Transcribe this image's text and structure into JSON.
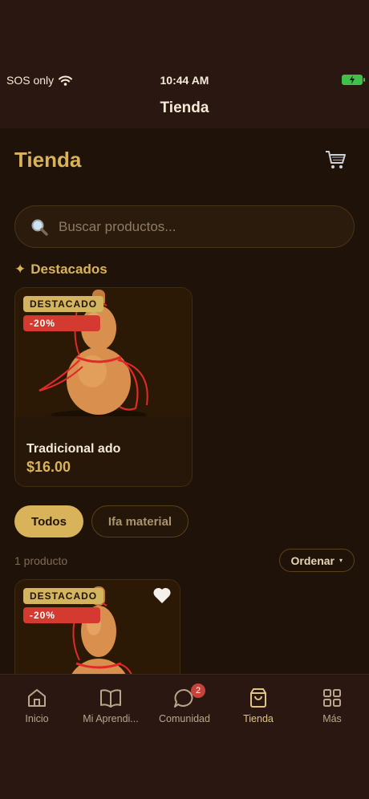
{
  "status": {
    "carrier": "SOS only",
    "time": "10:44 AM"
  },
  "nav": {
    "title": "Tienda"
  },
  "page": {
    "title": "Tienda"
  },
  "search": {
    "placeholder": "Buscar productos..."
  },
  "featured": {
    "section_label": "Destacados",
    "section_icon": "✦",
    "card": {
      "badge": "DESTACADO",
      "discount": "-20%",
      "name": "Tradicional ado",
      "price": "$16.00"
    }
  },
  "filters": {
    "chips": [
      "Todos",
      "Ifa material"
    ],
    "selected": "Todos"
  },
  "list": {
    "count": "1 producto",
    "sort_label": "Ordenar",
    "sort_caret": "▾",
    "card": {
      "badge": "DESTACADO",
      "discount": "-20%"
    }
  },
  "tabbar": {
    "items": [
      {
        "label": "Inicio",
        "icon": "home-icon"
      },
      {
        "label": "Mi Aprendi...",
        "icon": "book-icon"
      },
      {
        "label": "Comunidad",
        "icon": "chat-icon",
        "badge": "2"
      },
      {
        "label": "Tienda",
        "icon": "bag-icon",
        "active": true
      },
      {
        "label": "Más",
        "icon": "grid-icon"
      }
    ]
  },
  "colors": {
    "accent": "#d9b35a",
    "discount": "#d43a2f",
    "background": "#1f1208"
  }
}
